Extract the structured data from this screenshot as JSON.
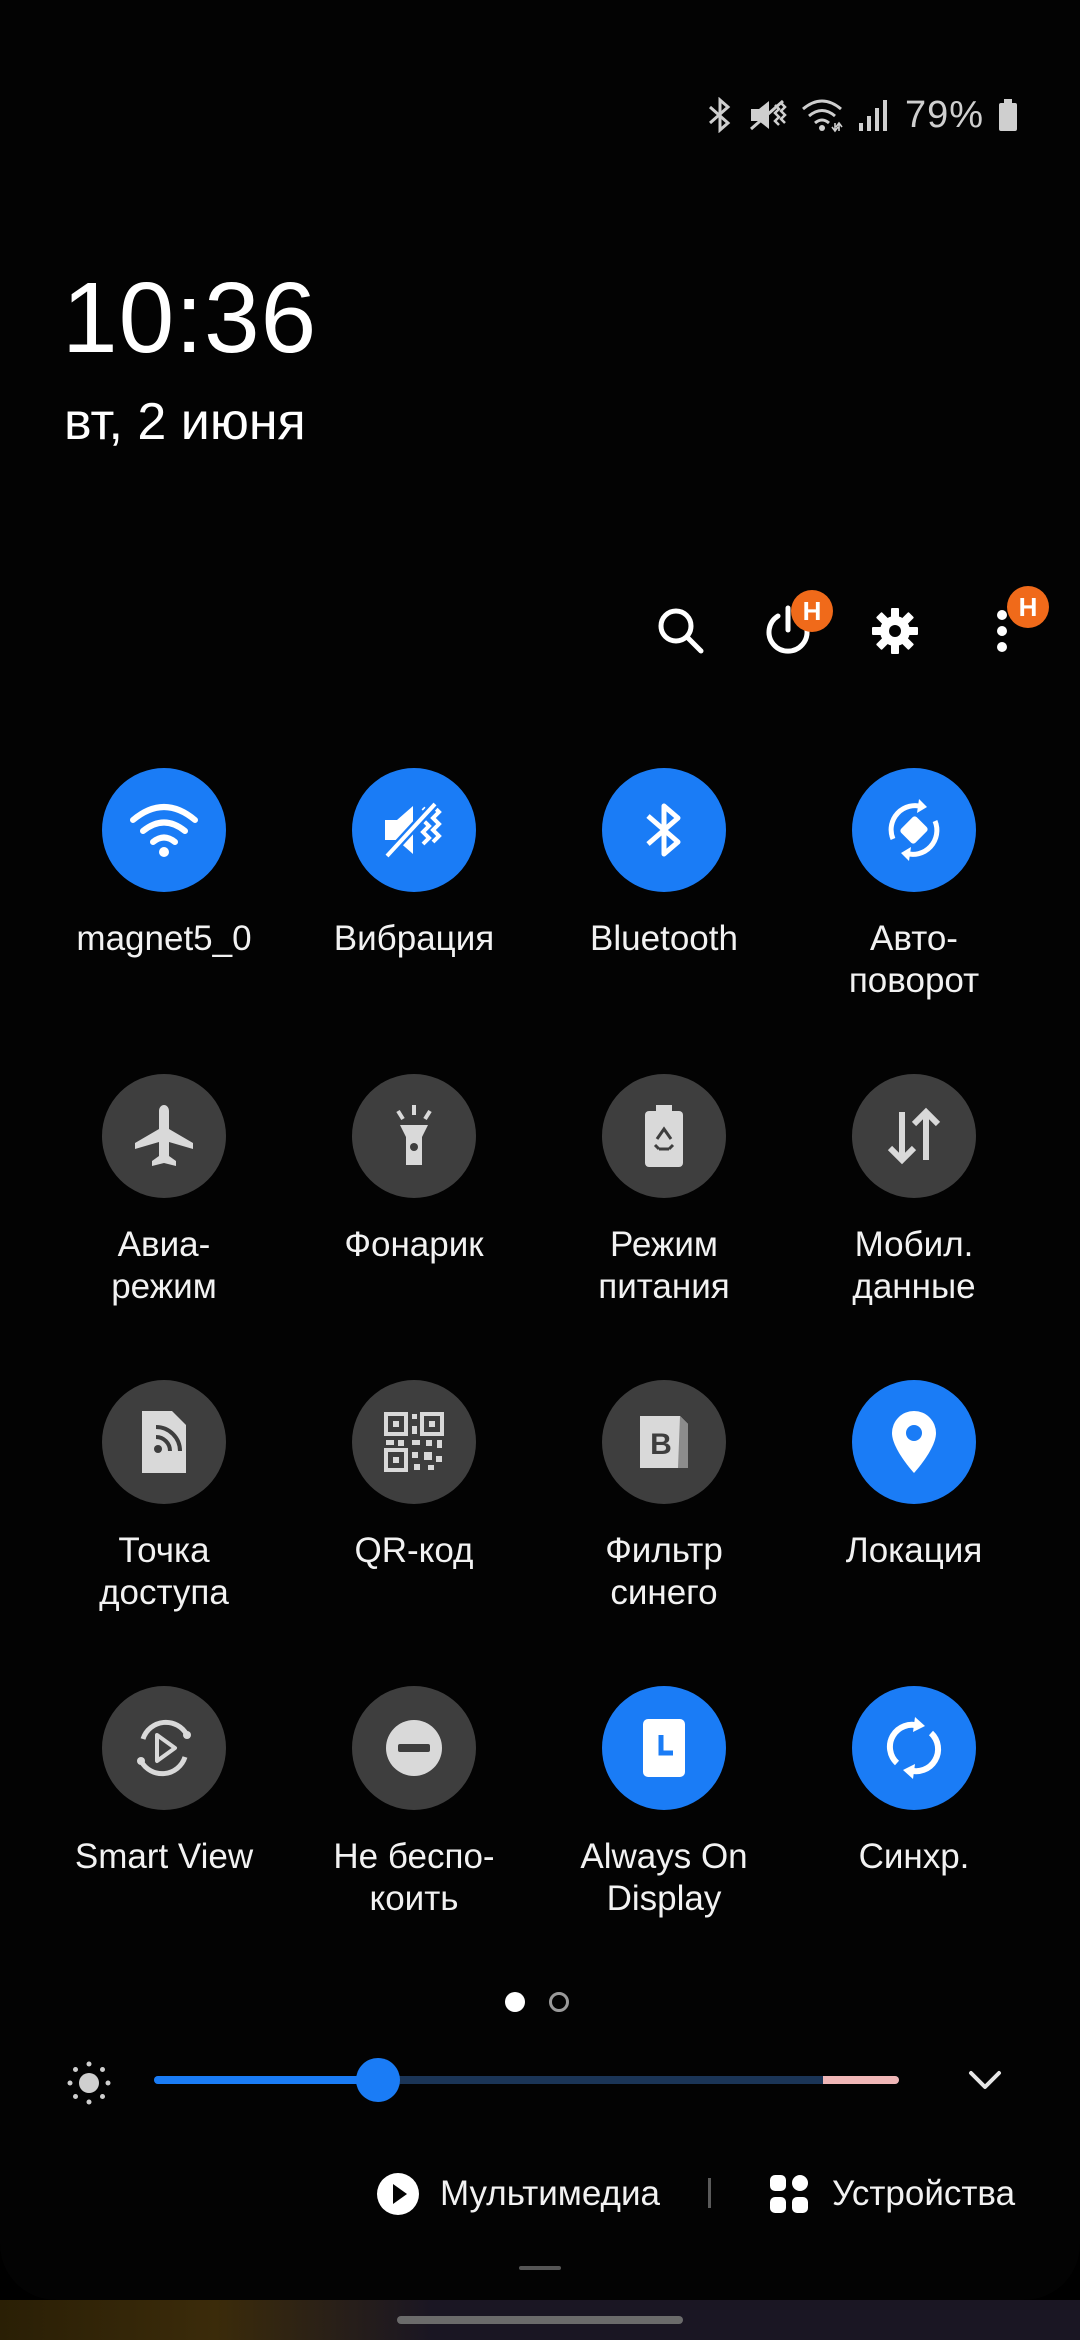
{
  "status_bar": {
    "battery_text": "79%",
    "icons": [
      "bluetooth-icon",
      "vibrate-icon",
      "wifi-icon",
      "signal-icon",
      "battery-icon"
    ]
  },
  "clock": {
    "time": "10:36",
    "date": "вт, 2 июня"
  },
  "header": {
    "icons": [
      "search-icon",
      "power-icon",
      "gear-icon",
      "more-icon"
    ],
    "power_badge": "H",
    "more_badge": "H"
  },
  "tiles": [
    {
      "label": "magnet5_0",
      "icon": "wifi-icon",
      "on": true
    },
    {
      "label": "Вибрация",
      "icon": "vibrate-icon",
      "on": true
    },
    {
      "label": "Bluetooth",
      "icon": "bluetooth-icon",
      "on": true
    },
    {
      "label": "Авто-\nповорот",
      "icon": "auto-rotate-icon",
      "on": true
    },
    {
      "label": "Авиа-\nрежим",
      "icon": "airplane-icon",
      "on": false
    },
    {
      "label": "Фонарик",
      "icon": "flashlight-icon",
      "on": false
    },
    {
      "label": "Режим\nпитания",
      "icon": "power-mode-icon",
      "on": false
    },
    {
      "label": "Мобил.\nданные",
      "icon": "mobile-data-icon",
      "on": false
    },
    {
      "label": "Точка\nдоступа",
      "icon": "hotspot-icon",
      "on": false
    },
    {
      "label": "QR-код",
      "icon": "qr-code-icon",
      "on": false
    },
    {
      "label": "Фильтр\nсинего",
      "icon": "blue-filter-icon",
      "on": false
    },
    {
      "label": "Локация",
      "icon": "location-icon",
      "on": true
    },
    {
      "label": "Smart View",
      "icon": "smart-view-icon",
      "on": false
    },
    {
      "label": "Не беспо-\nкоить",
      "icon": "do-not-disturb-icon",
      "on": false
    },
    {
      "label": "Always On\nDisplay",
      "icon": "always-on-display-icon",
      "on": true
    },
    {
      "label": "Синхр.",
      "icon": "sync-icon",
      "on": true
    }
  ],
  "pager": {
    "pages": 2,
    "current": 1
  },
  "brightness": {
    "level": 0.3
  },
  "bottom": {
    "media_label": "Мультимедиа",
    "devices_label": "Устройства"
  },
  "colors": {
    "accent": "#1a7cf6",
    "tile_off": "#3e3e3e",
    "badge": "#f06a1a"
  }
}
